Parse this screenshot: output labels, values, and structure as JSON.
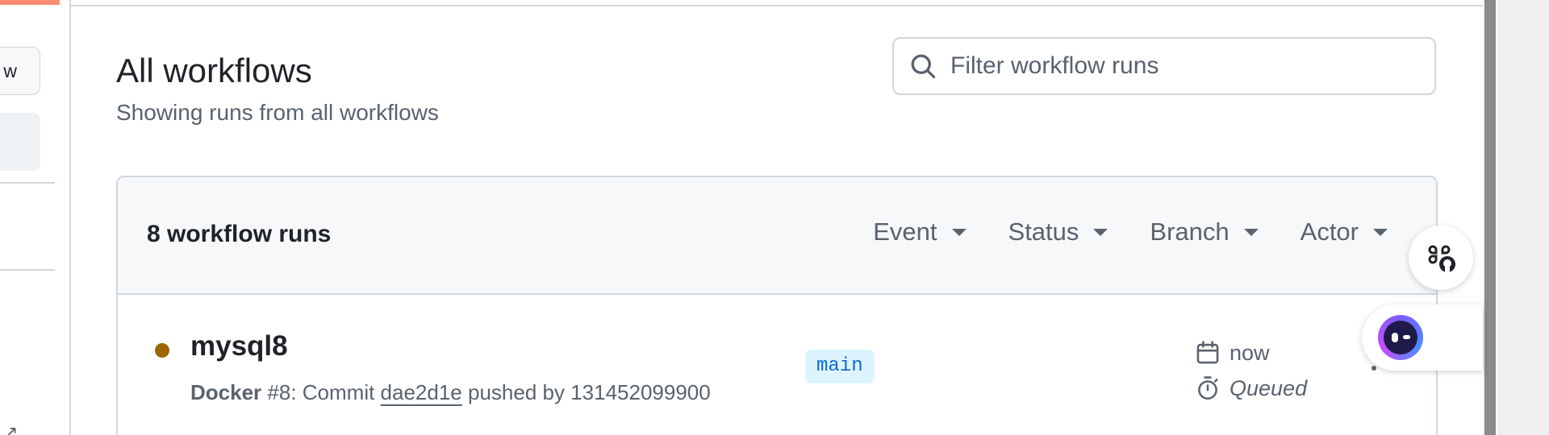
{
  "sidebar": {
    "new_button_label": "w",
    "external_link_icon": "arrow-up-right-icon"
  },
  "header": {
    "title": "All workflows",
    "subtitle": "Showing runs from all workflows"
  },
  "search": {
    "placeholder": "Filter workflow runs",
    "icon": "search-icon"
  },
  "runs": {
    "count_label": "8 workflow runs",
    "filters": [
      {
        "label": "Event"
      },
      {
        "label": "Status"
      },
      {
        "label": "Branch"
      },
      {
        "label": "Actor"
      }
    ],
    "items": [
      {
        "name": "mysql8",
        "status_color": "#9a6700",
        "workflow": "Docker",
        "run_number": "#8",
        "meta_prefix": ": Commit ",
        "commit": "dae2d1e",
        "meta_suffix": " pushed by 131452099900",
        "branch": "main",
        "time": "now",
        "state": "Queued"
      }
    ]
  },
  "colors": {
    "accent": "#fd8c73",
    "link": "#0969da",
    "branch_bg": "#ddf4ff",
    "muted_text": "#59636e",
    "border": "#d0d7de"
  },
  "floating": {
    "shortcut_icon": "command-github-icon",
    "assistant_icon": "assistant-face-icon"
  }
}
